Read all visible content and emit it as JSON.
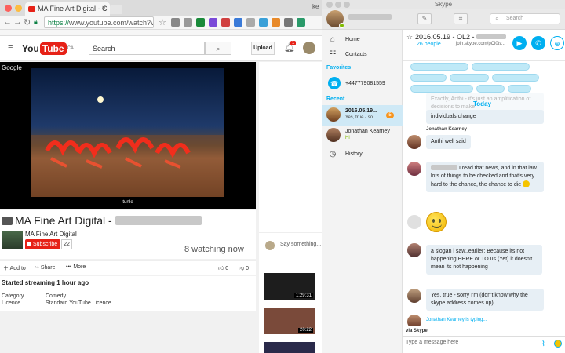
{
  "chrome": {
    "tab_title": "MA Fine Art Digital - Cl",
    "url_secure": "https://",
    "url_rest": "www.youtube.com/watch?v=",
    "traffic_colors": [
      "#fc605c",
      "#fdbc40",
      "#34c84a"
    ],
    "partial_tab": "ke"
  },
  "youtube": {
    "logo_you": "You",
    "logo_tube": "Tube",
    "logo_region": "CA",
    "search_placeholder": "Search",
    "upload_label": "Upload",
    "notification_count": "1",
    "player_label": "Google",
    "thumb_caption": "turtle",
    "video_title": "MA Fine Art Digital -",
    "channel_name": "MA Fine Art Digital",
    "subscribe_label": "Subscribe",
    "subscriber_count": "22",
    "watching": "8 watching now",
    "add_to": "Add to",
    "share": "Share",
    "more": "More",
    "likes": "0",
    "dislikes": "0",
    "started": "Started streaming 1 hour ago",
    "category_label": "Category",
    "category_value": "Comedy",
    "licence_label": "Licence",
    "licence_value": "Standard YouTube Licence",
    "chat_placeholder": "Say something...",
    "suggestions": [
      {
        "duration": "1:29:31",
        "color": "#1d1d1d"
      },
      {
        "duration": "20:22",
        "color": "#7a4a3a"
      },
      {
        "duration": "",
        "color": "#2a2a4a"
      }
    ]
  },
  "skype": {
    "window_title": "Skype",
    "search_placeholder": "Search",
    "nav": {
      "home": "Home",
      "contacts": "Contacts",
      "favorites_header": "Favorites",
      "favorite_number": "+447779081559",
      "recent_header": "Recent",
      "history": "History"
    },
    "recent": [
      {
        "name": "2016.05.19...",
        "preview": "Yes, true  - so...",
        "badge": "5"
      },
      {
        "name": "Jonathan Kearney",
        "preview": "Hi"
      }
    ],
    "conversation": {
      "title": "2016.05.19 - OL2 -",
      "people": "26 people",
      "join": "join.skype.com/pCl0tv...",
      "today": "Today",
      "typing": "Jonathan Kearney is typing...",
      "via": "via Skype",
      "compose_placeholder": "Type a message here"
    },
    "messages": [
      {
        "text": "Exactly, Anthi - it's just an amplification of decisions to make",
        "faded": true
      },
      {
        "text": "individuals change"
      },
      {
        "sender": "Jonathan Kearney",
        "text": "Anthi well said"
      },
      {
        "text": "I read that news, and in that law lots of things to be checked and that's very hard to the chance, the chance to die"
      },
      {
        "text": ""
      },
      {
        "text": "a slogan i saw..earlier: Because its not happening HERE or TO us (Yet) it doesn't mean its not happening"
      },
      {
        "text": "Yes, true  - sorry I'm  (don't know why the skype address comes up)"
      }
    ],
    "accent": "#00aff0"
  }
}
